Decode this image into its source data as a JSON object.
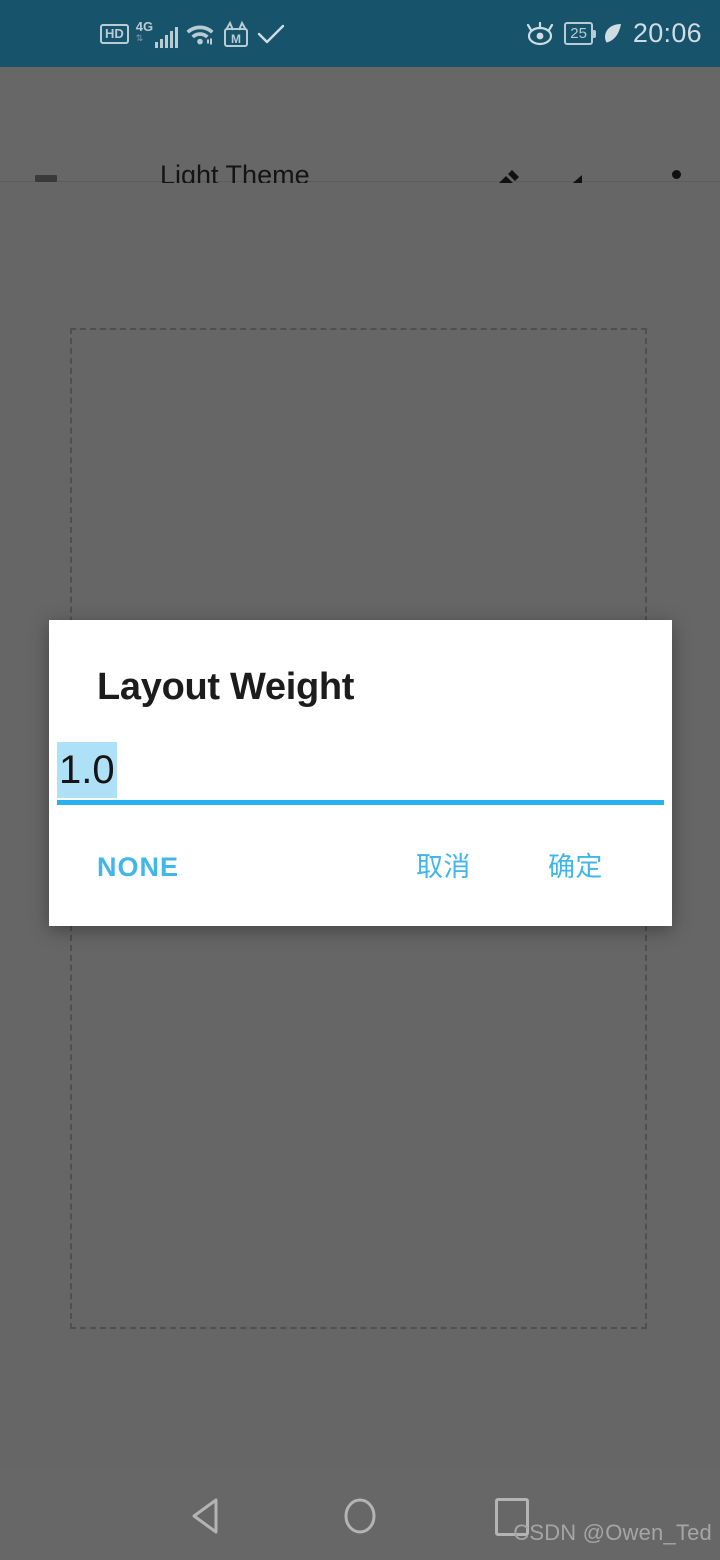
{
  "status_bar": {
    "background_color": "#17536b",
    "left_icons": [
      {
        "name": "hd-icon",
        "label": "HD"
      },
      {
        "name": "signal-4g-icon",
        "label": "4G",
        "sublabel": "1|)"
      },
      {
        "name": "wifi-icon",
        "label": ""
      },
      {
        "name": "app-m-icon",
        "label": "M"
      },
      {
        "name": "checkmark-icon",
        "label": ""
      }
    ],
    "right_icons": [
      {
        "name": "eye-care-icon",
        "label": ""
      },
      {
        "name": "battery-icon",
        "label": "25"
      },
      {
        "name": "power-saving-leaf-icon",
        "label": ""
      }
    ],
    "clock": "20:06"
  },
  "toolbar": {
    "background_color": "#676767",
    "menu_label": "menu",
    "title": "Light Theme\nSmall",
    "dropdown_label": "dropdown",
    "edit_label": "edit",
    "undo_label": "undo",
    "overflow_label": "more options"
  },
  "canvas": {
    "background_color": "#666666",
    "dashed_container_label": "layout container"
  },
  "dialog": {
    "title": "Layout Weight",
    "input": {
      "value": "1.0",
      "placeholder": "",
      "selected": true,
      "selection_color": "#aee1f7",
      "underline_color": "#29b0ef"
    },
    "buttons": {
      "none": "NONE",
      "cancel": "取消",
      "ok": "确定"
    },
    "accent_color": "#41b6e8",
    "background_color": "#ffffff"
  },
  "nav_bar": {
    "back_label": "back",
    "home_label": "home",
    "recents_label": "recents",
    "watermark": "CSDN @Owen_Ted"
  }
}
